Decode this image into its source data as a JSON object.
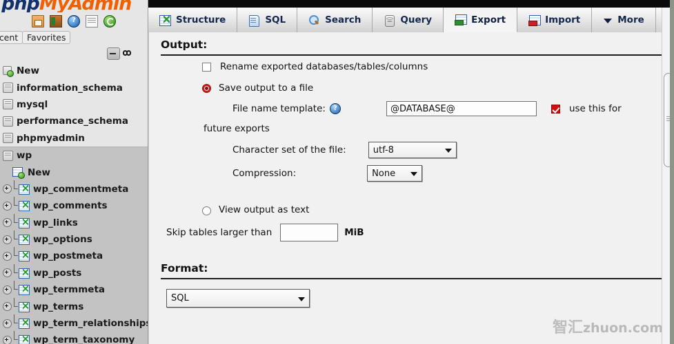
{
  "app": {
    "logo_php": "php",
    "logo_myadmin": "MyAdmin",
    "watermark_cn": "智汇",
    "watermark_en": "zhuon.com"
  },
  "sidebar": {
    "toolbar_icons": [
      {
        "name": "home-icon",
        "glyph": ""
      },
      {
        "name": "exit-icon",
        "glyph": ""
      },
      {
        "name": "help-icon",
        "glyph": "?"
      },
      {
        "name": "documentation-icon",
        "glyph": ""
      },
      {
        "name": "reload-icon",
        "glyph": ""
      }
    ],
    "tabs": [
      {
        "label": "Recent"
      },
      {
        "label": "Favorites"
      }
    ],
    "new_db_label": "New",
    "databases": [
      {
        "label": "information_schema"
      },
      {
        "label": "mysql"
      },
      {
        "label": "performance_schema"
      },
      {
        "label": "phpmyadmin"
      }
    ],
    "active_db": "wp",
    "active_db_new": "New",
    "tables": [
      {
        "label": "wp_commentmeta"
      },
      {
        "label": "wp_comments"
      },
      {
        "label": "wp_links"
      },
      {
        "label": "wp_options"
      },
      {
        "label": "wp_postmeta"
      },
      {
        "label": "wp_posts"
      },
      {
        "label": "wp_termmeta"
      },
      {
        "label": "wp_terms"
      },
      {
        "label": "wp_term_relationships"
      },
      {
        "label": "wp_term_taxonomy"
      }
    ]
  },
  "nav": {
    "tabs": [
      {
        "label": "Structure",
        "icon": "structure-icon",
        "active": false
      },
      {
        "label": "SQL",
        "icon": "sql-icon",
        "active": false
      },
      {
        "label": "Search",
        "icon": "search-icon",
        "active": false
      },
      {
        "label": "Query",
        "icon": "query-icon",
        "active": false
      },
      {
        "label": "Export",
        "icon": "export-icon",
        "active": true
      },
      {
        "label": "Import",
        "icon": "import-icon",
        "active": false
      },
      {
        "label": "More",
        "icon": "chevron-down-icon",
        "active": false
      }
    ]
  },
  "output": {
    "heading": "Output:",
    "rename_label": "Rename exported databases/tables/columns",
    "rename_checked": false,
    "save_to_file_label": "Save output to a file",
    "save_to_file_selected": true,
    "filename_template_label": "File name template:",
    "help_glyph": "?",
    "filename_template_value": "@DATABASE@",
    "use_this_label": "use this for",
    "use_this_checked": true,
    "future_exports_label": "future exports",
    "charset_label": "Character set of the file:",
    "charset_value": "utf-8",
    "charset_options": [
      "utf-8"
    ],
    "compression_label": "Compression:",
    "compression_value": "None",
    "compression_options": [
      "None"
    ],
    "view_as_text_label": "View output as text",
    "view_as_text_selected": false,
    "skip_label": "Skip tables larger than",
    "skip_value": "",
    "skip_unit": "MiB"
  },
  "format": {
    "heading": "Format:",
    "value": "SQL",
    "options": [
      "SQL"
    ]
  }
}
